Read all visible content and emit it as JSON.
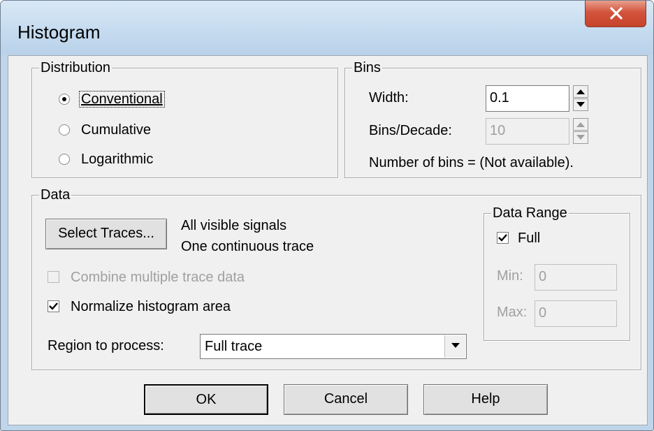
{
  "window": {
    "title": "Histogram"
  },
  "distribution": {
    "legend": "Distribution",
    "options": [
      {
        "label": "Conventional",
        "selected": true
      },
      {
        "label": "Cumulative",
        "selected": false
      },
      {
        "label": "Logarithmic",
        "selected": false
      }
    ]
  },
  "bins": {
    "legend": "Bins",
    "width_label": "Width:",
    "width_value": "0.1",
    "per_decade_label": "Bins/Decade:",
    "per_decade_value": "10",
    "count_text": "Number of bins = (Not available)."
  },
  "data": {
    "legend": "Data",
    "select_traces_label": "Select Traces...",
    "selection_line1": "All visible signals",
    "selection_line2": "One continuous trace",
    "combine_label": "Combine multiple trace data",
    "normalize_label": "Normalize histogram area",
    "region_label": "Region to process:",
    "region_value": "Full trace"
  },
  "data_range": {
    "legend": "Data Range",
    "full_label": "Full",
    "min_label": "Min:",
    "min_value": "0",
    "max_label": "Max:",
    "max_value": "0"
  },
  "buttons": {
    "ok": "OK",
    "cancel": "Cancel",
    "help": "Help"
  }
}
